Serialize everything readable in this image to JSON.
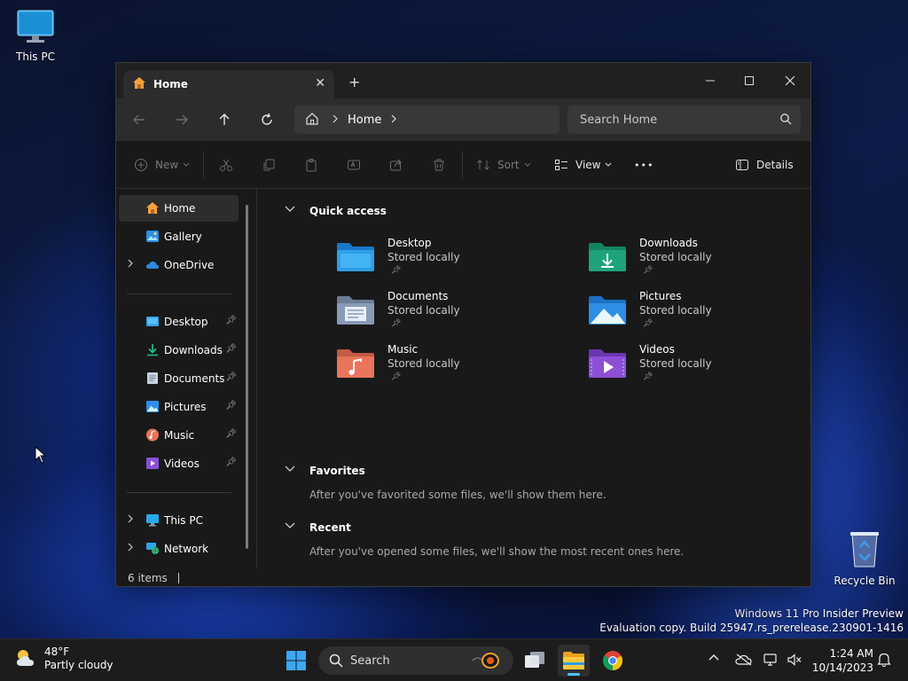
{
  "desktop": {
    "icons": {
      "this_pc": "This PC",
      "recycle_bin": "Recycle Bin"
    },
    "watermark": {
      "line1": "Windows 11 Pro Insider Preview",
      "line2": "Evaluation copy. Build 25947.rs_prerelease.230901-1416"
    }
  },
  "window": {
    "tab_title": "Home",
    "tab_close": "✕",
    "new_tab": "+",
    "address": {
      "home_icon": "home-icon",
      "crumb": "Home"
    },
    "search_placeholder": "Search Home",
    "toolbar": {
      "new": "New",
      "sort": "Sort",
      "view": "View",
      "more": "•••",
      "details": "Details"
    },
    "sidebar": {
      "top": [
        {
          "label": "Home",
          "icon": "home-icon",
          "selected": true
        },
        {
          "label": "Gallery",
          "icon": "gallery-icon"
        },
        {
          "label": "OneDrive",
          "icon": "cloud-icon",
          "expandable": true
        }
      ],
      "pinned": [
        {
          "label": "Desktop",
          "icon": "desktop-icon"
        },
        {
          "label": "Downloads",
          "icon": "download-icon"
        },
        {
          "label": "Documents",
          "icon": "document-icon"
        },
        {
          "label": "Pictures",
          "icon": "pictures-icon"
        },
        {
          "label": "Music",
          "icon": "music-icon"
        },
        {
          "label": "Videos",
          "icon": "video-icon"
        }
      ],
      "bottom": [
        {
          "label": "This PC",
          "icon": "pc-icon"
        },
        {
          "label": "Network",
          "icon": "network-icon"
        }
      ]
    },
    "quick_access": {
      "title": "Quick access",
      "items": [
        {
          "name": "Desktop",
          "sub": "Stored locally",
          "color": "#2f9ee8"
        },
        {
          "name": "Downloads",
          "sub": "Stored locally",
          "color": "#1fa37a"
        },
        {
          "name": "Documents",
          "sub": "Stored locally",
          "color": "#8a9bb5"
        },
        {
          "name": "Pictures",
          "sub": "Stored locally",
          "color": "#2e8fe6"
        },
        {
          "name": "Music",
          "sub": "Stored locally",
          "color": "#e8745a"
        },
        {
          "name": "Videos",
          "sub": "Stored locally",
          "color": "#8c4fd6"
        }
      ]
    },
    "favorites": {
      "title": "Favorites",
      "empty": "After you've favorited some files, we'll show them here."
    },
    "recent": {
      "title": "Recent",
      "empty": "After you've opened some files, we'll show the most recent ones here."
    },
    "status": "6 items"
  },
  "taskbar": {
    "weather": {
      "temp": "48°F",
      "desc": "Partly cloudy"
    },
    "search": "Search",
    "clock": {
      "time": "1:24 AM",
      "date": "10/14/2023"
    }
  },
  "colors": {
    "accent": "#4cc2ff",
    "window_bg": "#191919",
    "navbar_bg": "#2c2c2c"
  }
}
